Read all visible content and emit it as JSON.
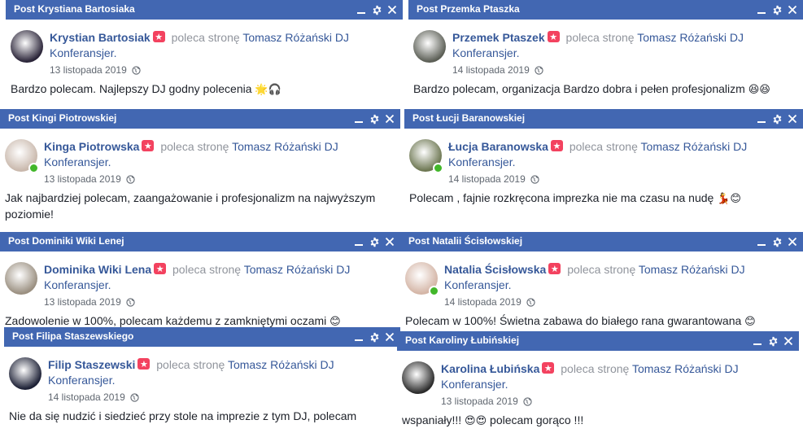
{
  "posts": [
    {
      "title": "Post Krystiana Bartosiaka",
      "author": "Krystian Bartosiak",
      "verb": "poleca stronę",
      "page_line1": "Tomasz Różański DJ",
      "page_line2": "Konferansjer.",
      "date": "13 listopada 2019",
      "text": "Bardzo polecam. Najlepszy DJ godny polecenia",
      "emoji": "🌟🎧",
      "avatar_color": "#2a2438",
      "online": false
    },
    {
      "title": "Post Przemka Ptaszka",
      "author": "Przemek Ptaszek",
      "verb": "poleca stronę",
      "page_line1": "Tomasz Różański DJ",
      "page_line2": "Konferansjer.",
      "date": "14 listopada 2019",
      "text": "Bardzo polecam, organizacja Bardzo dobra i pełen profesjonalizm",
      "emoji": "😆😆",
      "avatar_color": "#5b5e55",
      "online": false
    },
    {
      "title": "Post Kingi Piotrowskiej",
      "author": "Kinga Piotrowska",
      "verb": "poleca stronę",
      "page_line1": "Tomasz Różański DJ",
      "page_line2": "Konferansjer.",
      "date": "13 listopada 2019",
      "text": "Jak najbardziej polecam, zaangażowanie i profesjonalizm na najwyższym poziomie!",
      "emoji": "",
      "avatar_color": "#c9b8ac",
      "online": true
    },
    {
      "title": "Post Łucji Baranowskiej",
      "author": "Łucja Baranowska",
      "verb": "poleca stronę",
      "page_line1": "Tomasz Różański DJ",
      "page_line2": "Konferansjer.",
      "date": "14 listopada 2019",
      "text": "Polecam , fajnie rozkręcona imprezka nie ma czasu na nudę",
      "emoji": "💃😊",
      "avatar_color": "#6d7752",
      "online": true
    },
    {
      "title": "Post Dominiki Wiki Lenej",
      "author": "Dominika Wiki Lena",
      "verb": "poleca stronę",
      "page_line1": "Tomasz Różański DJ",
      "page_line2": "Konferansjer.",
      "date": "13 listopada 2019",
      "text": "Zadowolenie w 100%, polecam każdemu z zamkniętymi oczami",
      "emoji": "😊",
      "avatar_color": "#9a8f80",
      "online": false
    },
    {
      "title": "Post Natalii Ścisłowskiej",
      "author": "Natalia Ścisłowska",
      "verb": "poleca stronę",
      "page_line1": "Tomasz Różański DJ",
      "page_line2": "Konferansjer.",
      "date": "14 listopada 2019",
      "text": "Polecam w 100%! Świetna zabawa do białego rana gwarantowana",
      "emoji": "😊",
      "avatar_color": "#d4b5a6",
      "online": true
    },
    {
      "title": "Post Filipa Staszewskiego",
      "author": "Filip Staszewski",
      "verb": "poleca stronę",
      "page_line1": "Tomasz Różański DJ",
      "page_line2": "Konferansjer.",
      "date": "14 listopada 2019",
      "text": "Nie da się nudzić i siedzieć przy stole na imprezie z tym DJ, polecam",
      "emoji": "",
      "avatar_color": "#1c2035",
      "online": false
    },
    {
      "title": "Post Karoliny Łubińskiej",
      "author": "Karolina Łubińska",
      "verb": "poleca stronę",
      "page_line1": "Tomasz Różański DJ",
      "page_line2": "Konferansjer.",
      "date": "13 listopada 2019",
      "text": "wspaniały!!!",
      "emoji": "😍😍",
      "text_after": "polecam gorąco !!!",
      "avatar_color": "#2b2b2b",
      "online": false
    }
  ],
  "colors": {
    "titlebar": "#4267b2",
    "link": "#365899",
    "badge": "#f3425f",
    "online": "#42b72a"
  },
  "icons": {
    "minimize": "minimize-icon",
    "settings": "gear-icon",
    "close": "close-icon",
    "audience": "globe-icon",
    "badge": "recommendation-star-icon"
  }
}
